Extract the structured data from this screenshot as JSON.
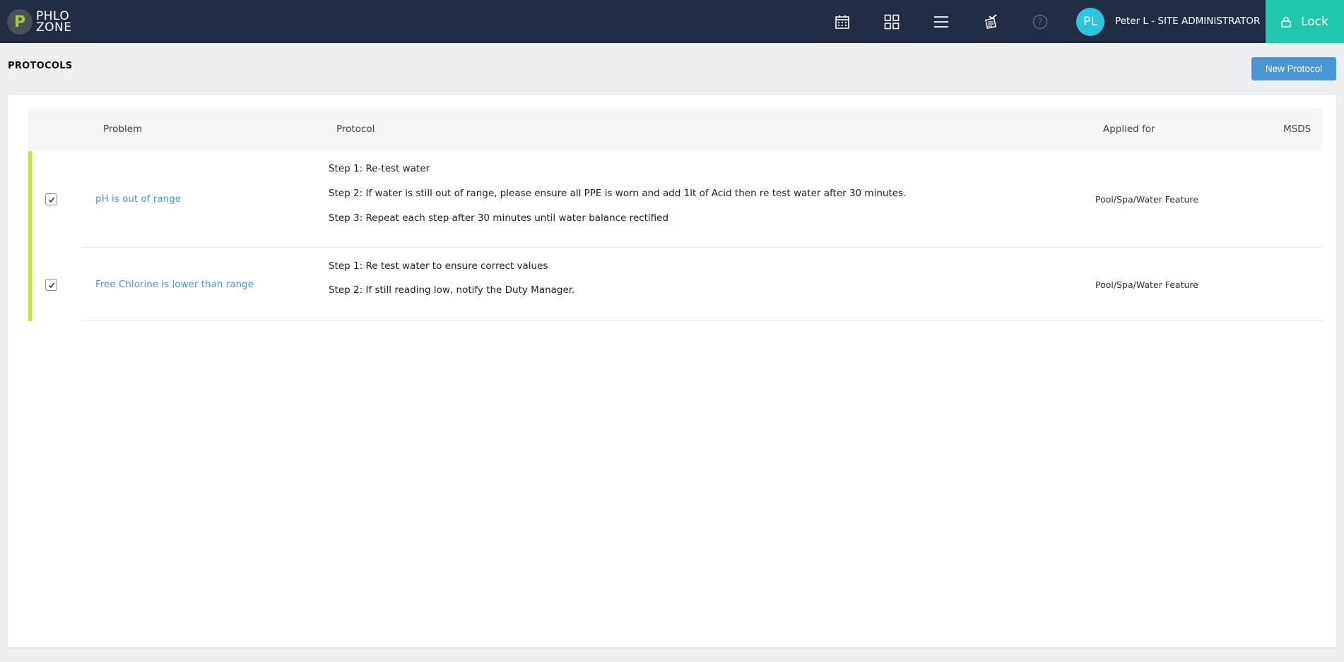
{
  "topbar": {
    "logo_letter": "P",
    "logo_line1": "PHLO",
    "logo_line2": "ZONE",
    "icons": [
      "calendar-icon",
      "grid-icon",
      "menu-icon",
      "checklist-icon",
      "help-icon"
    ],
    "avatar_initials": "PL",
    "user_label": "Peter L - SITE ADMINISTRATOR",
    "lock_label": "Lock"
  },
  "page": {
    "title": "PROTOCOLS",
    "new_button": "New Protocol"
  },
  "table": {
    "headers": {
      "problem": "Problem",
      "protocol": "Protocol",
      "applied_for": "Applied for",
      "msds": "MSDS"
    },
    "rows": [
      {
        "problem": "pH is out of range",
        "steps": [
          "Step 1: Re-test water",
          "Step 2: If water is still out of range, please ensure all PPE is worn and add 1lt of Acid then re test water after 30 minutes.",
          "Step 3: Repeat each step after 30 minutes until water balance rectified"
        ],
        "applied_for": "Pool/Spa/Water Feature",
        "msds": "",
        "checked": true
      },
      {
        "problem": "Free Chlorine is lower than range",
        "steps": [
          "Step 1: Re test water to ensure correct values",
          "Step 2: If still reading low, notify the Duty Manager."
        ],
        "applied_for": "Pool/Spa/Water Feature",
        "msds": "",
        "checked": true
      }
    ]
  },
  "colors": {
    "topbar": "#222d44",
    "accent_green": "#c8e03a",
    "lock_teal": "#1fc8a8",
    "primary_blue": "#4a96d2",
    "avatar": "#2bc5e0"
  }
}
